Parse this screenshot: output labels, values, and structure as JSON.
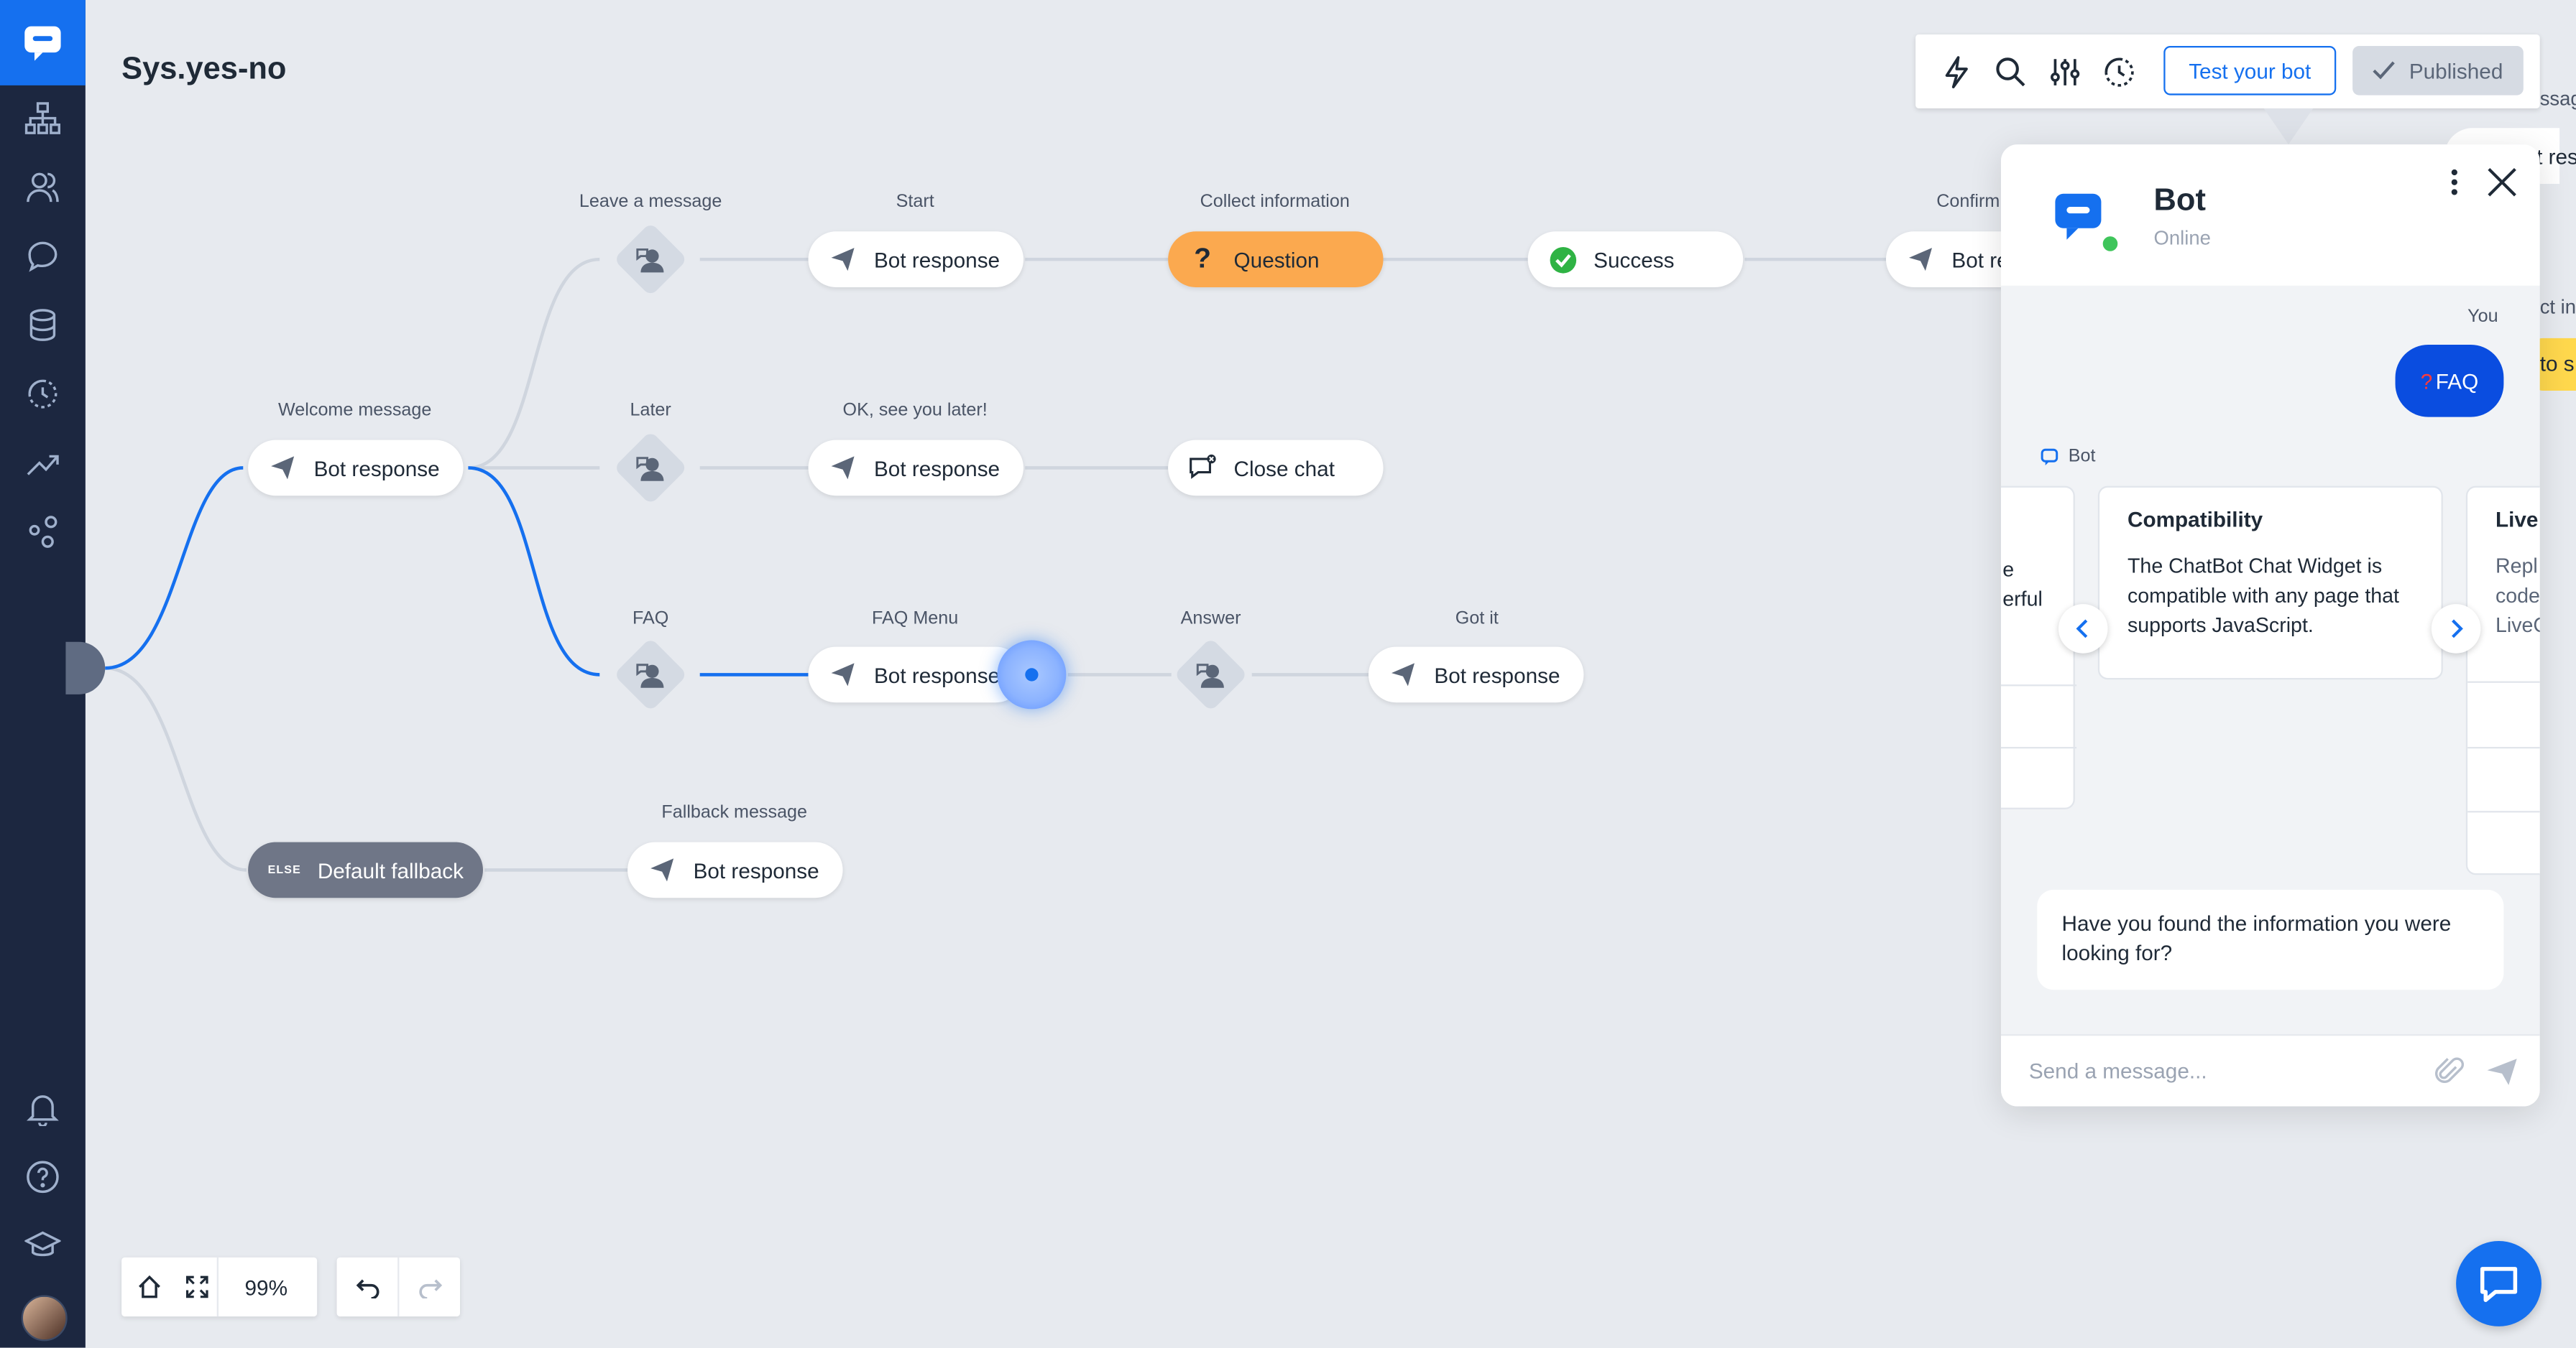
{
  "page": {
    "title": "Sys.yes-no"
  },
  "toolbar": {
    "test_label": "Test your bot",
    "published_label": "Published",
    "icons": [
      "lightning-icon",
      "search-icon",
      "sliders-icon",
      "history-icon"
    ]
  },
  "flow": {
    "labels": {
      "leave_message": "Leave a message",
      "start": "Start",
      "collect_info": "Collect information",
      "confirm": "Confirm",
      "welcome": "Welcome message",
      "later": "Later",
      "ok_see_you": "OK, see you later!",
      "faq": "FAQ",
      "faq_menu": "FAQ Menu",
      "answer": "Answer",
      "got_it": "Got it",
      "fallback_msg": "Fallback message"
    },
    "nodes": {
      "bot_response": "Bot response",
      "question": "Question",
      "success": "Success",
      "close_chat": "Close chat",
      "default_fallback": "Default fallback",
      "else_tag": "ELSE",
      "bot_re": "Bot re"
    },
    "peek": {
      "p1": "ssag",
      "p2": "t res",
      "p3": "ct in",
      "p4": "to s"
    }
  },
  "chat": {
    "bot_name": "Bot",
    "status": "Online",
    "you_label": "You",
    "faq_message": "FAQ",
    "faq_emoji": "?",
    "bot_label": "Bot",
    "left_card_fragments": [
      "e",
      "erful"
    ],
    "card": {
      "title": "Compatibility",
      "body": "The ChatBot Chat Widget is compatible with any page that supports JavaScript."
    },
    "right_card": {
      "title": "Live",
      "body_lines": [
        "Repl",
        "code",
        "LiveC"
      ]
    },
    "bot_message": "Have you found the information you were looking for?",
    "input_placeholder": "Send a message..."
  },
  "controls": {
    "zoom": "99%"
  },
  "colors": {
    "sidebar": "#1c2740",
    "brand": "#1570ef",
    "question": "#fba94f",
    "fallback": "#6f7687"
  }
}
